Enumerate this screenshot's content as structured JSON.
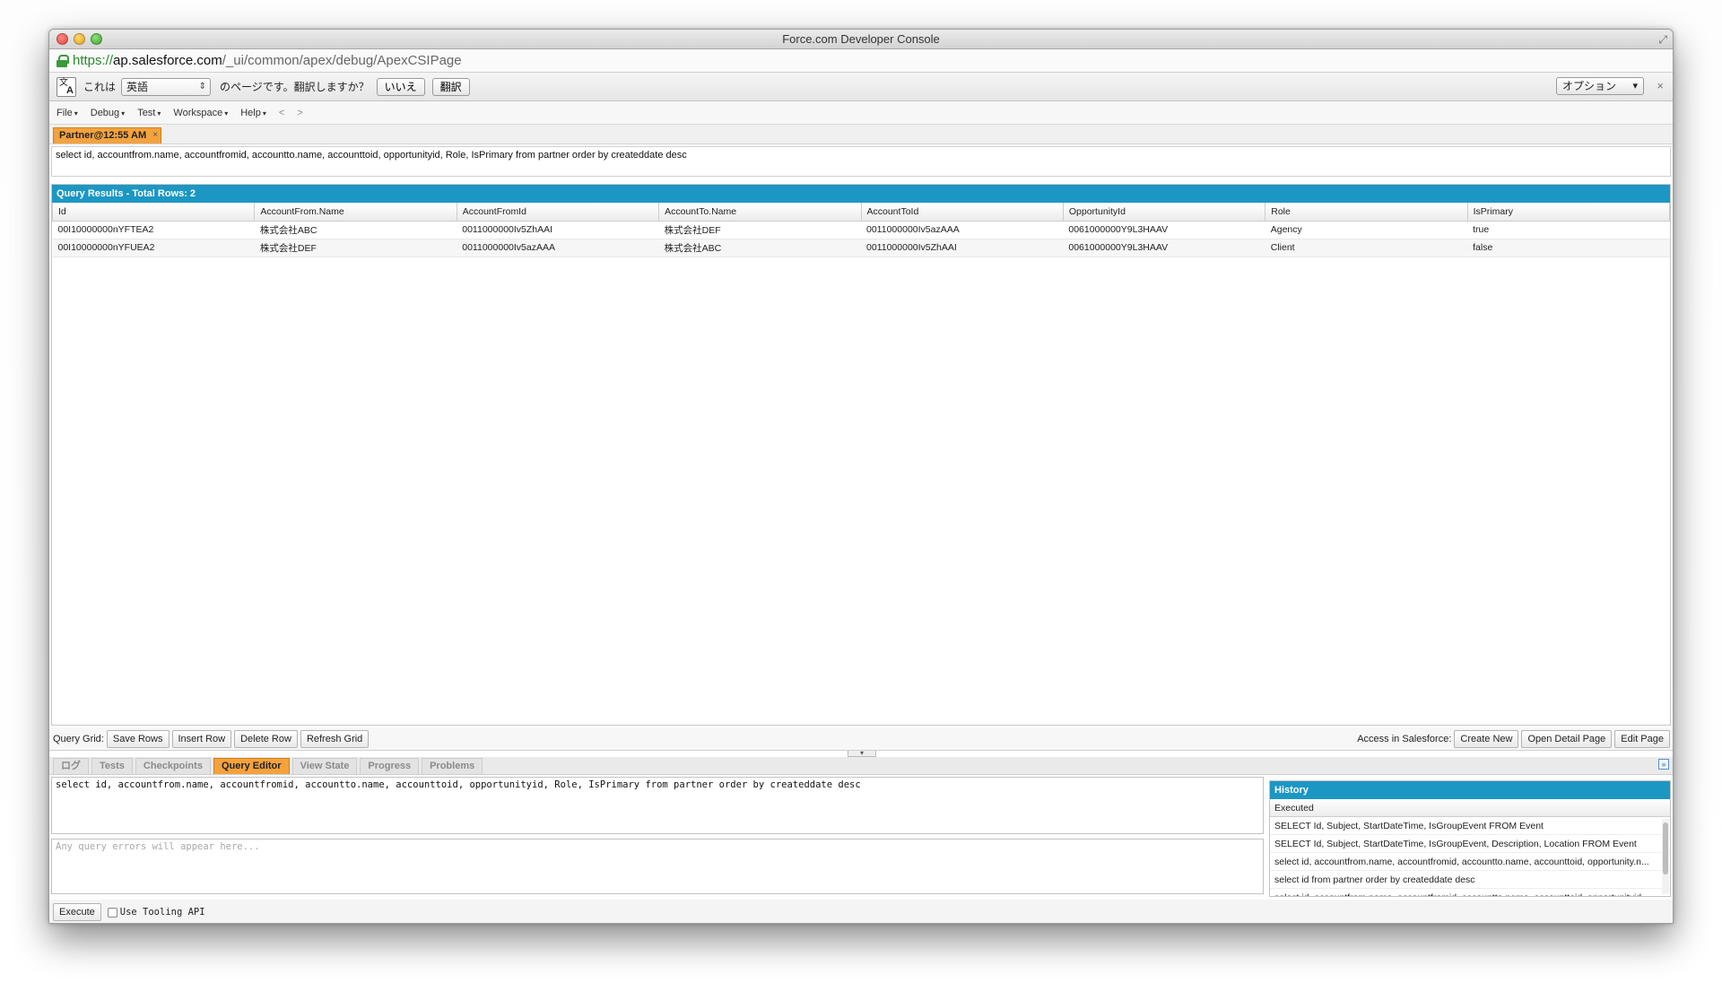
{
  "window": {
    "title": "Force.com Developer Console"
  },
  "url": {
    "scheme": "https://",
    "host": "ap.salesforce.com",
    "path": "/_ui/common/apex/debug/ApexCSIPage"
  },
  "translate": {
    "prefix": "これは",
    "language": "英語",
    "suffix": "のページです。翻訳しますか？",
    "no_label": "いいえ",
    "translate_label": "翻訳",
    "options_label": "オプション",
    "close_glyph": "×",
    "icon_glyph_a": "文",
    "icon_glyph_b": "A"
  },
  "menu": {
    "items": [
      "File",
      "Debug",
      "Test",
      "Workspace",
      "Help"
    ],
    "back": "<",
    "forward": ">"
  },
  "file_tab": {
    "label": "Partner@12:55 AM",
    "close": "×"
  },
  "query_text": "select id, accountfrom.name, accountfromid, accountto.name, accounttoid, opportunityid, Role, IsPrimary from partner order by createddate desc",
  "results": {
    "header": "Query Results - Total Rows: 2",
    "columns": [
      "Id",
      "AccountFrom.Name",
      "AccountFromId",
      "AccountTo.Name",
      "AccountToId",
      "OpportunityId",
      "Role",
      "IsPrimary"
    ],
    "rows": [
      [
        "00I10000000nYFTEA2",
        "株式会社ABC",
        "0011000000Iv5ZhAAI",
        "株式会社DEF",
        "0011000000Iv5azAAA",
        "0061000000Y9L3HAAV",
        "Agency",
        "true"
      ],
      [
        "00I10000000nYFUEA2",
        "株式会社DEF",
        "0011000000Iv5azAAA",
        "株式会社ABC",
        "0011000000Iv5ZhAAI",
        "0061000000Y9L3HAAV",
        "Client",
        "false"
      ]
    ]
  },
  "grid_toolbar": {
    "label": "Query Grid:",
    "buttons": [
      "Save Rows",
      "Insert Row",
      "Delete Row",
      "Refresh Grid"
    ],
    "access_label": "Access in Salesforce:",
    "access_buttons": [
      "Create New",
      "Open Detail Page",
      "Edit Page"
    ]
  },
  "bottom_tabs": [
    "ログ",
    "Tests",
    "Checkpoints",
    "Query Editor",
    "View State",
    "Progress",
    "Problems"
  ],
  "active_bottom_tab": "Query Editor",
  "editor": {
    "text": "select id, accountfrom.name, accountfromid, accountto.name, accounttoid, opportunityid, Role, IsPrimary from partner order by createddate desc",
    "errors_placeholder": "Any query errors will appear here..."
  },
  "history": {
    "title": "History",
    "column": "Executed",
    "items": [
      "SELECT Id, Subject, StartDateTime, IsGroupEvent FROM Event",
      "SELECT Id, Subject, StartDateTime, IsGroupEvent, Description, Location FROM Event",
      "select id, accountfrom.name, accountfromid, accountto.name, accounttoid, opportunity.n...",
      "select id from partner order by createddate desc",
      "select id, accountfrom.name, accountfromid, accountto.name, accounttoid, opportunityid..."
    ]
  },
  "execute": {
    "button": "Execute",
    "tooling_label": "Use Tooling API",
    "tooling_checked": false
  },
  "colors": {
    "accent_blue": "#1c97c3",
    "tab_orange": "#f3a23e"
  }
}
